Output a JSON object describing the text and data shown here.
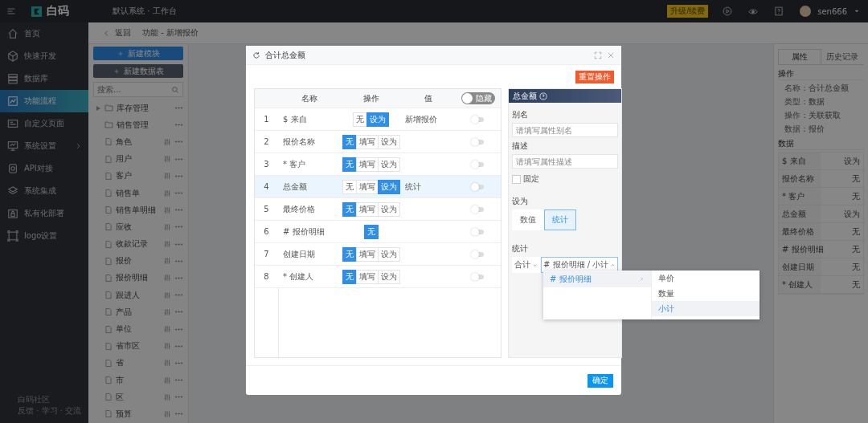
{
  "topbar": {
    "logo": "白码",
    "workspace": "默认系统 · 工作台",
    "upgrade": "升级/续费",
    "user": "sen666"
  },
  "sidebar": {
    "items": [
      {
        "label": "首页",
        "selected": false,
        "has_arrow": false
      },
      {
        "label": "快速开发",
        "selected": false,
        "has_arrow": false
      },
      {
        "label": "数据库",
        "selected": false,
        "has_arrow": false
      },
      {
        "label": "功能流程",
        "selected": true,
        "has_arrow": false
      },
      {
        "label": "自定义页面",
        "selected": false,
        "has_arrow": false
      },
      {
        "label": "系统设置",
        "selected": false,
        "has_arrow": true
      },
      {
        "label": "API对接",
        "selected": false,
        "has_arrow": false
      },
      {
        "label": "系统集成",
        "selected": false,
        "has_arrow": false
      },
      {
        "label": "私有化部署",
        "selected": false,
        "has_arrow": false
      },
      {
        "label": "logo设置",
        "selected": false,
        "has_arrow": false
      }
    ],
    "footer": {
      "title": "白码社区",
      "subtitle": "反馈 · 学习 · 交流"
    }
  },
  "breadcrumb": {
    "back": "返回",
    "title": "功能 - 新增报价"
  },
  "module_panel": {
    "buttons": [
      {
        "label": "新建模块",
        "kind": "primary"
      },
      {
        "label": "新建数据表",
        "kind": "dark"
      }
    ],
    "search": {
      "placeholder": "搜索..."
    },
    "tree": [
      {
        "label": "库存管理",
        "kind": "group"
      },
      {
        "label": "销售管理",
        "kind": "folder"
      },
      {
        "label": "角色",
        "kind": "table"
      },
      {
        "label": "用户",
        "kind": "table"
      },
      {
        "label": "客户",
        "kind": "table"
      },
      {
        "label": "销售单",
        "kind": "table"
      },
      {
        "label": "销售单明细",
        "kind": "table"
      },
      {
        "label": "应收",
        "kind": "table"
      },
      {
        "label": "收款记录",
        "kind": "table"
      },
      {
        "label": "报价",
        "kind": "table"
      },
      {
        "label": "报价明细",
        "kind": "table"
      },
      {
        "label": "跟进人",
        "kind": "table"
      },
      {
        "label": "产品",
        "kind": "table"
      },
      {
        "label": "单位",
        "kind": "table"
      },
      {
        "label": "省市区",
        "kind": "table"
      },
      {
        "label": "省",
        "kind": "table"
      },
      {
        "label": "市",
        "kind": "table"
      },
      {
        "label": "区",
        "kind": "table"
      },
      {
        "label": "预算",
        "kind": "table"
      }
    ]
  },
  "props_panel": {
    "tabs": [
      {
        "label": "属性",
        "selected": true
      },
      {
        "label": "历史记录",
        "selected": false
      }
    ],
    "operation_title": "操作",
    "info": [
      {
        "label": "名称：",
        "value": "合计总金额"
      },
      {
        "label": "类型：",
        "value": "数据"
      },
      {
        "label": "操作：",
        "value": "关联获取"
      },
      {
        "label": "数据：",
        "value": "报价"
      }
    ],
    "data_title": "数据",
    "data_rows": [
      {
        "name": "$ 来自",
        "value": "设为"
      },
      {
        "name": "报价名称",
        "value": "无"
      },
      {
        "name": "* 客户",
        "value": "无"
      },
      {
        "name": "总金额",
        "value": "设为"
      },
      {
        "name": "最终价格",
        "value": "无"
      },
      {
        "name": "# 报价明细",
        "value": "无"
      },
      {
        "name": "创建日期",
        "value": "无"
      },
      {
        "name": "* 创建人",
        "value": "无"
      }
    ]
  },
  "dialog": {
    "title": "合计总金额",
    "reset_button": "重置操作",
    "confirm": "确定",
    "table": {
      "columns": [
        "名称",
        "操作",
        "值"
      ],
      "toggle_label": "隐藏",
      "toggle_on": false,
      "rows": [
        {
          "index": "1",
          "name": "$ 来自",
          "selected": false,
          "on": false,
          "value": "新增报价",
          "options": [
            {
              "label": "无",
              "selected": false
            },
            {
              "label": "设为",
              "selected": true
            }
          ]
        },
        {
          "index": "2",
          "name": "报价名称",
          "selected": false,
          "on": false,
          "options": [
            {
              "label": "无",
              "selected": true
            },
            {
              "label": "填写",
              "selected": false
            },
            {
              "label": "设为",
              "selected": false
            }
          ]
        },
        {
          "index": "3",
          "name": "* 客户",
          "selected": false,
          "on": false,
          "options": [
            {
              "label": "无",
              "selected": true
            },
            {
              "label": "填写",
              "selected": false
            },
            {
              "label": "设为",
              "selected": false
            }
          ]
        },
        {
          "index": "4",
          "name": "总金额",
          "selected": true,
          "on": false,
          "value": "统计",
          "options": [
            {
              "label": "无",
              "selected": false
            },
            {
              "label": "填写",
              "selected": false
            },
            {
              "label": "设为",
              "selected": true
            }
          ]
        },
        {
          "index": "5",
          "name": "最终价格",
          "selected": false,
          "on": false,
          "options": [
            {
              "label": "无",
              "selected": true
            },
            {
              "label": "填写",
              "selected": false
            },
            {
              "label": "设为",
              "selected": false
            }
          ]
        },
        {
          "index": "6",
          "name": "# 报价明细",
          "selected": false,
          "on": false,
          "options": [
            {
              "label": "无",
              "selected": true
            }
          ]
        },
        {
          "index": "7",
          "name": "创建日期",
          "selected": false,
          "on": false,
          "options": [
            {
              "label": "无",
              "selected": true
            },
            {
              "label": "填写",
              "selected": false
            },
            {
              "label": "设为",
              "selected": false
            }
          ]
        },
        {
          "index": "8",
          "name": "* 创建人",
          "selected": false,
          "on": false,
          "options": [
            {
              "label": "无",
              "selected": true
            },
            {
              "label": "填写",
              "selected": false
            },
            {
              "label": "设为",
              "selected": false
            }
          ]
        }
      ]
    },
    "field_panel": {
      "title": "总金额",
      "alias": {
        "label": "别名",
        "placeholder": "请填写属性别名"
      },
      "description": {
        "label": "描述",
        "placeholder": "请填写属性描述"
      },
      "fixed": {
        "label": "固定",
        "checked": false
      },
      "set_as": {
        "label": "设为",
        "options": [
          {
            "label": "数值",
            "selected": false
          },
          {
            "label": "统计",
            "selected": true
          }
        ]
      },
      "stat": {
        "label": "统计",
        "aggregate": "合计",
        "field": "# 报价明细 / 小计",
        "expanded": true
      }
    },
    "menu": {
      "groups": [
        {
          "label": "# 报价明细",
          "selected": true
        }
      ],
      "items": [
        {
          "label": "单价",
          "selected": false
        },
        {
          "label": "数量",
          "selected": false
        },
        {
          "label": "小计",
          "selected": true
        }
      ]
    }
  }
}
